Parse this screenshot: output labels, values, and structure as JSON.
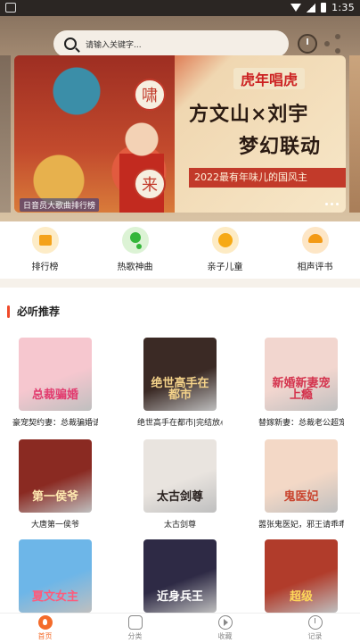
{
  "status_bar": {
    "time": "1:35"
  },
  "search": {
    "placeholder": "请输入关键字..."
  },
  "banner": {
    "seal_top": "啸",
    "seal_bottom": "来",
    "tag": "虎年唱虎",
    "headline_line1": "方文山×刘宇",
    "headline_line2": "梦幻联动",
    "subline": "2022最有年味儿的国风主",
    "caption": "日音员大歌曲排行榜"
  },
  "categories": [
    {
      "label": "排行榜",
      "icon": "ranking-icon",
      "color": "#f4a21a"
    },
    {
      "label": "热歌神曲",
      "icon": "music-note-icon",
      "color": "#34b63a"
    },
    {
      "label": "亲子儿童",
      "icon": "child-face-icon",
      "color": "#f6a914"
    },
    {
      "label": "相声评书",
      "icon": "crosstalk-icon",
      "color": "#f39a15"
    }
  ],
  "section": {
    "title": "必听推荐"
  },
  "books": [
    {
      "title": "豪宠契约妻：总裁骗婚请当...",
      "cover_text": "总裁骗婚",
      "cover_bg": "#f6c7cf",
      "cover_fg": "#e23a6e"
    },
    {
      "title": "绝世高手在都市|完结放心听|...",
      "cover_text": "绝世高手在都市",
      "cover_bg": "#3b2a25",
      "cover_fg": "#f5d38a"
    },
    {
      "title": "替嫁新妻：总裁老公超宠我...",
      "cover_text": "新婚新妻宠上瘾",
      "cover_bg": "#f2d6cf",
      "cover_fg": "#d4344e"
    },
    {
      "title": "大唐第一侯爷",
      "cover_text": "第一侯爷",
      "cover_bg": "#8a2a22",
      "cover_fg": "#ffe9b0"
    },
    {
      "title": "太古剑尊",
      "cover_text": "太古剑尊",
      "cover_bg": "#e9e4df",
      "cover_fg": "#2a2220"
    },
    {
      "title": "嚣张鬼医妃，邪王请乖乖",
      "cover_text": "鬼医妃",
      "cover_bg": "#f3d8c6",
      "cover_fg": "#c9442e"
    },
    {
      "title": "",
      "cover_text": "夏文女主",
      "cover_bg": "#6db6e8",
      "cover_fg": "#ff5a7a"
    },
    {
      "title": "",
      "cover_text": "近身兵王",
      "cover_bg": "#2e2a45",
      "cover_fg": "#ffffff"
    },
    {
      "title": "",
      "cover_text": "超级",
      "cover_bg": "#b13c2b",
      "cover_fg": "#ffd85a"
    }
  ],
  "tabs": [
    {
      "label": "首页",
      "icon": "home-icon",
      "active": true
    },
    {
      "label": "分类",
      "icon": "category-icon",
      "active": false
    },
    {
      "label": "收藏",
      "icon": "favorite-icon",
      "active": false
    },
    {
      "label": "记录",
      "icon": "history-icon",
      "active": false
    }
  ]
}
